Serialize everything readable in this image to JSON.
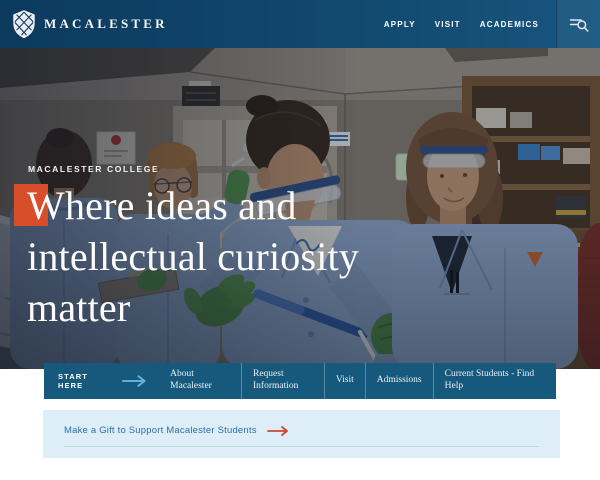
{
  "header": {
    "brand": "MACALESTER",
    "nav": [
      {
        "label": "APPLY"
      },
      {
        "label": "VISIT"
      },
      {
        "label": "ACADEMICS"
      }
    ],
    "search_icon": "menu-search-icon"
  },
  "hero": {
    "eyebrow": "MACALESTER COLLEGE",
    "heading_lines": [
      "Where ideas and",
      "intellectual curiosity",
      "matter"
    ]
  },
  "quicknav": {
    "start_label": "START HERE",
    "arrow_icon": "right-arrow-icon",
    "items": [
      "About Macalester",
      "Request Information",
      "Visit",
      "Admissions",
      "Current Students - Find Help"
    ]
  },
  "banner": {
    "link_label": "Make a Gift to Support Macalester Students",
    "arrow_icon": "right-arrow-icon"
  },
  "colors": {
    "header_navy": "#0c3a5e",
    "header_navy_light": "#175580",
    "quicknav_teal": "#16597c",
    "accent_orange": "#d94e2a",
    "banner_bg": "#ddeef9",
    "banner_link_blue": "#2f6fa7",
    "banner_arrow_red": "#c84a2e",
    "start_arrow_blue": "#63b1dc"
  }
}
